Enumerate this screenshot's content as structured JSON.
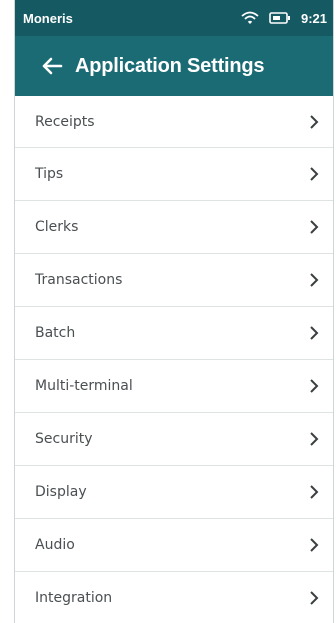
{
  "status_bar": {
    "carrier": "Moneris",
    "time": "9:21",
    "icons": [
      "wifi-icon",
      "battery-icon"
    ]
  },
  "header": {
    "back_icon": "arrow-left-icon",
    "title": "Application Settings"
  },
  "menu": {
    "items": [
      {
        "label": "Receipts",
        "icon": "chevron-right-icon"
      },
      {
        "label": "Tips",
        "icon": "chevron-right-icon"
      },
      {
        "label": "Clerks",
        "icon": "chevron-right-icon"
      },
      {
        "label": "Transactions",
        "icon": "chevron-right-icon"
      },
      {
        "label": "Batch",
        "icon": "chevron-right-icon"
      },
      {
        "label": "Multi-terminal",
        "icon": "chevron-right-icon"
      },
      {
        "label": "Security",
        "icon": "chevron-right-icon"
      },
      {
        "label": "Display",
        "icon": "chevron-right-icon"
      },
      {
        "label": "Audio",
        "icon": "chevron-right-icon"
      },
      {
        "label": "Integration",
        "icon": "chevron-right-icon"
      }
    ]
  },
  "colors": {
    "status_bar_bg": "#155a63",
    "header_bg": "#1b6b75",
    "text": "#4a4f52",
    "divider": "#dfe3e4"
  }
}
